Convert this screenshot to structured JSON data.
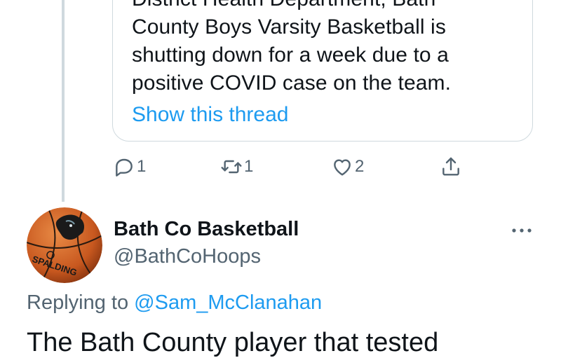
{
  "quoted_tweet": {
    "text": "District Health Department, Bath\nCounty Boys Varsity Basketball is\nshutting down for a week due to a\npositive COVID case on the team.",
    "show_thread_label": "Show this thread"
  },
  "actions": {
    "reply_count": "1",
    "retweet_count": "1",
    "like_count": "2",
    "icons": [
      "reply-icon",
      "retweet-icon",
      "like-icon",
      "share-icon"
    ]
  },
  "reply_tweet": {
    "display_name": "Bath Co Basketball",
    "handle": "@BathCoHoops",
    "avatar_text": "SPALDING",
    "replying_prefix": "Replying to",
    "replying_to": "@Sam_McClanahan",
    "text": "The Bath County player that tested"
  },
  "colors": {
    "accent": "#1d9bf0",
    "secondary_text": "#536471",
    "border": "#cfd9de",
    "basketball": "#d4682a"
  }
}
